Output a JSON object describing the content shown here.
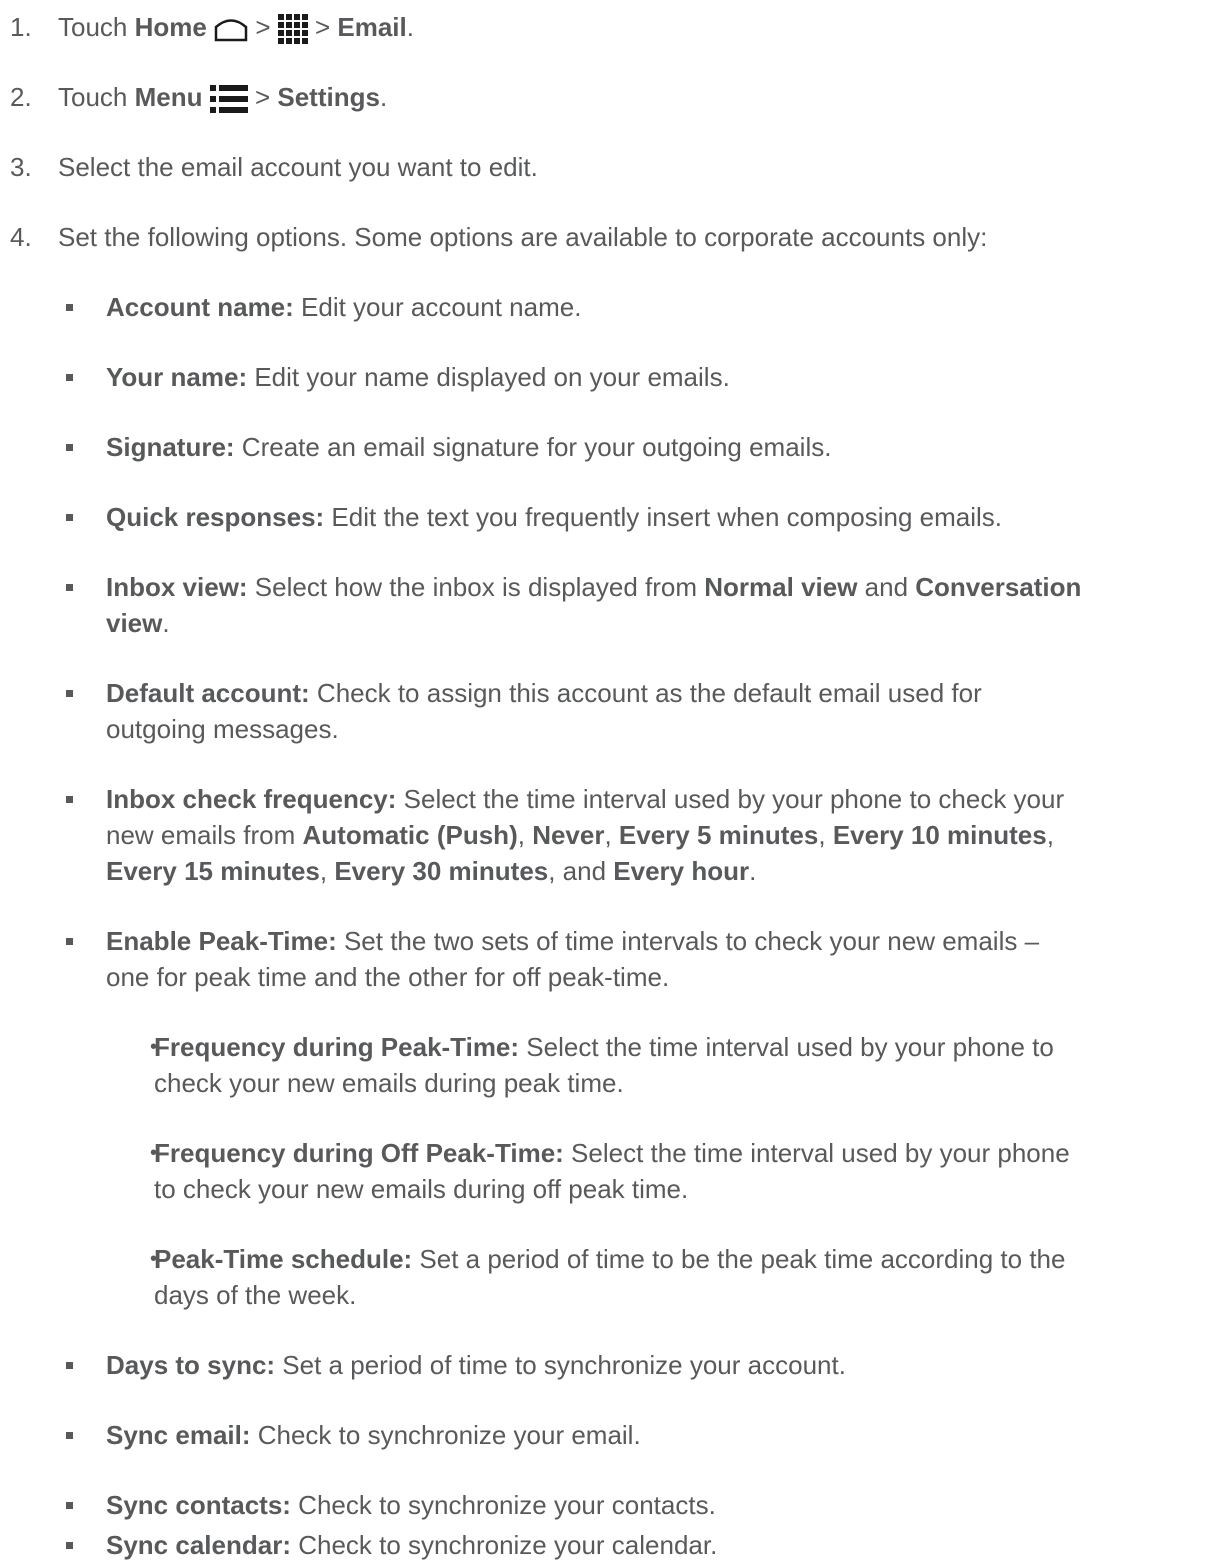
{
  "steps": [
    {
      "num": "1.",
      "parts": [
        "Touch ",
        "Home",
        " > ",
        " > ",
        "Email",
        "."
      ]
    },
    {
      "num": "2.",
      "parts": [
        "Touch ",
        "Menu",
        " > ",
        "Settings",
        "."
      ]
    },
    {
      "num": "3.",
      "text": "Select the email account you want to edit."
    },
    {
      "num": "4.",
      "text": "Set the following options. Some options are available to corporate accounts only:"
    }
  ],
  "options": [
    {
      "label": "Account name:",
      "desc": " Edit your account name."
    },
    {
      "label": "Your name:",
      "desc": " Edit your name displayed on your emails."
    },
    {
      "label": "Signature:",
      "desc": " Create an email signature for your outgoing emails."
    },
    {
      "label": "Quick responses:",
      "desc": " Edit the text you frequently insert when composing emails."
    },
    {
      "label": "Inbox view:",
      "desc": " Select how the inbox is displayed from ",
      "b1": "Normal view",
      "mid": " and ",
      "b2": "Conversation",
      "l2b": "view",
      "l2end": "."
    },
    {
      "label": "Default account:",
      "desc": " Check to assign this account as the default email used for",
      "line2": "outgoing messages."
    },
    {
      "label": "Inbox check frequency:",
      "desc": " Select the time interval used by your phone to check your",
      "line2_pre": "new emails from ",
      "f1": "Automatic (Push)",
      "s": ", ",
      "f2": "Never",
      "f3": "Every 5 minutes",
      "f4": "Every 10 minutes",
      "comma": ",",
      "f5": "Every 15 minutes",
      "f6": "Every 30 minutes",
      "and": ", and ",
      "f7": "Every hour",
      "dot": "."
    },
    {
      "label": "Enable Peak-Time:",
      "desc": " Set the two sets of time intervals to check your new emails –",
      "line2": "one for peak time and the other for off peak-time."
    }
  ],
  "suboptions": [
    {
      "label": "Frequency during Peak-Time:",
      "desc": " Select the time interval used by your phone to",
      "line2": "check your new emails during peak time."
    },
    {
      "label": "Frequency during Off Peak-Time:",
      "desc": " Select the time interval used by your phone",
      "line2": "to check your new emails during off peak time."
    },
    {
      "label": "Peak-Time schedule:",
      "desc": " Set a period of time to be the peak time according to the",
      "line2": "days of the week."
    }
  ],
  "options2": [
    {
      "label": "Days to sync:",
      "desc": " Set a period of time to synchronize your account."
    },
    {
      "label": "Sync email:",
      "desc": " Check to synchronize your email."
    },
    {
      "label": "Sync contacts:",
      "desc": " Check to synchronize your contacts."
    },
    {
      "label": "Sync calendar:",
      "desc": " Check to synchronize your calendar."
    }
  ],
  "icons": {
    "home": "home-outline-icon",
    "apps": "apps-grid-icon",
    "menu": "menu-list-icon"
  },
  "colors": {
    "text": "#58595b",
    "icon": "#1a1a1a"
  }
}
